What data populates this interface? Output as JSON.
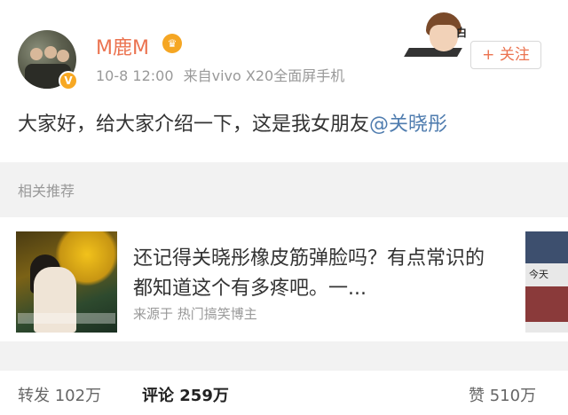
{
  "post": {
    "author": "M鹿M",
    "crown_icon": "crown-icon",
    "verified_badge": "V",
    "time": "10-8 12:00",
    "source": "来自vivo X20全面屏手机",
    "follow_label": "+ 关注",
    "sticker_mark": "白",
    "text_main": "大家好，给大家介绍一下，这是我女朋友",
    "mention": "@关晓彤"
  },
  "related": {
    "section_title": "相关推荐",
    "card": {
      "title": "还记得关晓彤橡皮筋弹脸吗？有点常识的都知道这个有多疼吧。一...",
      "source": "来源于  热门搞笑博主",
      "peek_label": "今天"
    }
  },
  "stats": {
    "repost_label": "转发",
    "repost_count": "102万",
    "comment_label": "评论",
    "comment_count": "259万",
    "like_label": "赞",
    "like_count": "510万"
  },
  "colors": {
    "accent": "#eb7350",
    "mention": "#507daf",
    "muted": "#999999"
  }
}
